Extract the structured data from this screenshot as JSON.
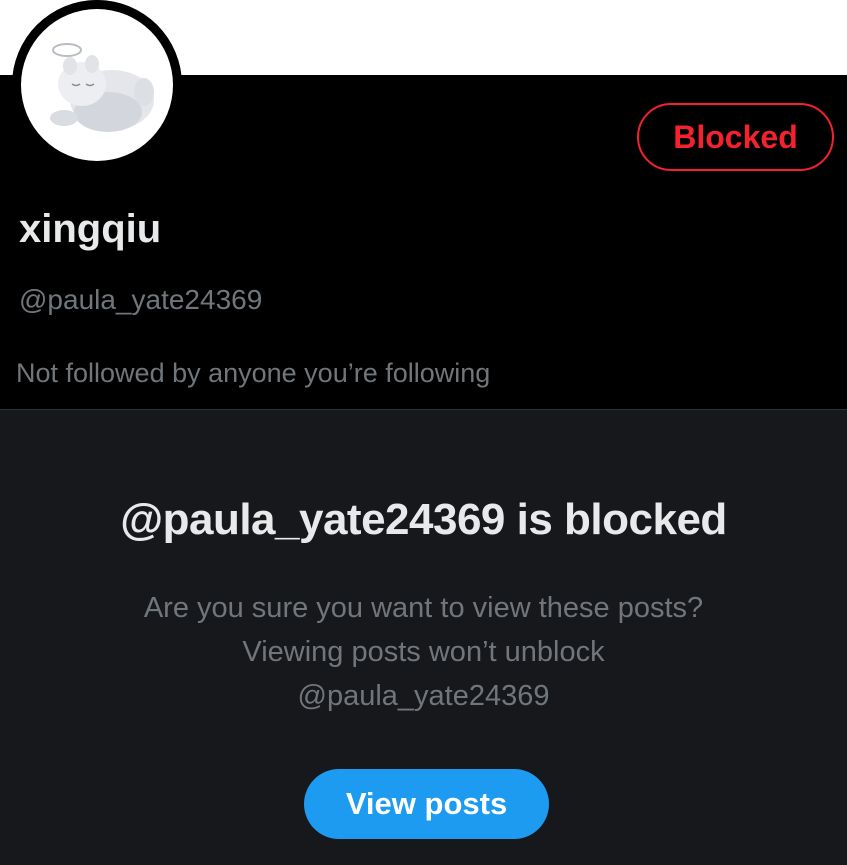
{
  "profile": {
    "display_name": "xingqiu",
    "handle": "@paula_yate24369",
    "followers_note": "Not followed by anyone you’re following",
    "blocked_label": "Blocked",
    "avatar_icon": "sleeping-cat-angel-icon"
  },
  "blocked_notice": {
    "title": "@paula_yate24369 is blocked",
    "description": "Are you sure you want to view these posts? Viewing posts won’t unblock @paula_yate24369",
    "view_posts_label": "View posts"
  },
  "colors": {
    "accent": "#1d9bf0",
    "danger": "#f4212e",
    "background": "#000000",
    "panel": "#16181c",
    "text_primary": "#e7e9ea",
    "text_secondary": "#71767b"
  }
}
